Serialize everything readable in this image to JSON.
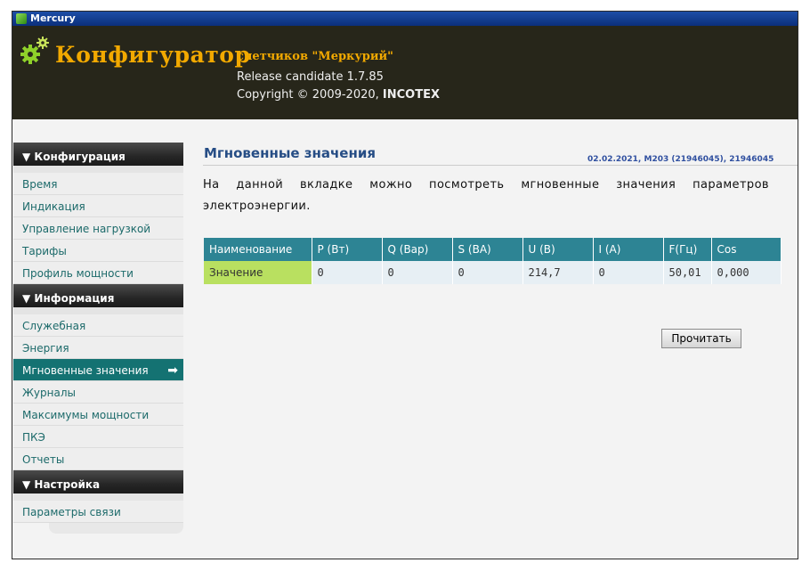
{
  "window": {
    "title": "Mercury"
  },
  "header": {
    "brand": "Конфигуратор",
    "subtitle": "счетчиков \"Меркурий\"",
    "release": "Release candidate 1.7.85",
    "copyright_prefix": "Copyright © 2009-2020, ",
    "copyright_company": "INCOTEX"
  },
  "sidebar": {
    "sections": [
      {
        "label": "▼ Конфигурация",
        "items": [
          {
            "label": "Время"
          },
          {
            "label": "Индикация"
          },
          {
            "label": "Управление нагрузкой"
          },
          {
            "label": "Тарифы"
          },
          {
            "label": "Профиль мощности"
          }
        ]
      },
      {
        "label": "▼ Информация",
        "items": [
          {
            "label": "Служебная"
          },
          {
            "label": "Энергия"
          },
          {
            "label": "Мгновенные значения"
          },
          {
            "label": "Журналы"
          },
          {
            "label": "Максимумы мощности"
          },
          {
            "label": "ПКЭ"
          },
          {
            "label": "Отчеты"
          }
        ]
      },
      {
        "label": "▼ Настройка",
        "items": [
          {
            "label": "Параметры связи"
          }
        ]
      }
    ],
    "active_arrow": "➡"
  },
  "main": {
    "title": "Мгновенные значения",
    "meta": "02.02.2021, M203 (21946045), 21946045",
    "description": "На данной вкладке можно посмотреть мгновенные значения параметров электроэнергии.",
    "table": {
      "headers": [
        "Наименование",
        "P (Вт)",
        "Q (Вар)",
        "S (ВА)",
        "U (В)",
        "I (А)",
        "F(Гц)",
        "Cos"
      ],
      "row_label": "Значение",
      "values": [
        "0",
        "0",
        "0",
        "214,7",
        "0",
        "50,01",
        "0,000"
      ]
    },
    "read_button": "Прочитать"
  },
  "colors": {
    "header_bg": "#27261a",
    "brand": "#f2a900",
    "accent_teal": "#147272",
    "table_header": "#2d8494",
    "row_label_bg": "#b9e060"
  }
}
